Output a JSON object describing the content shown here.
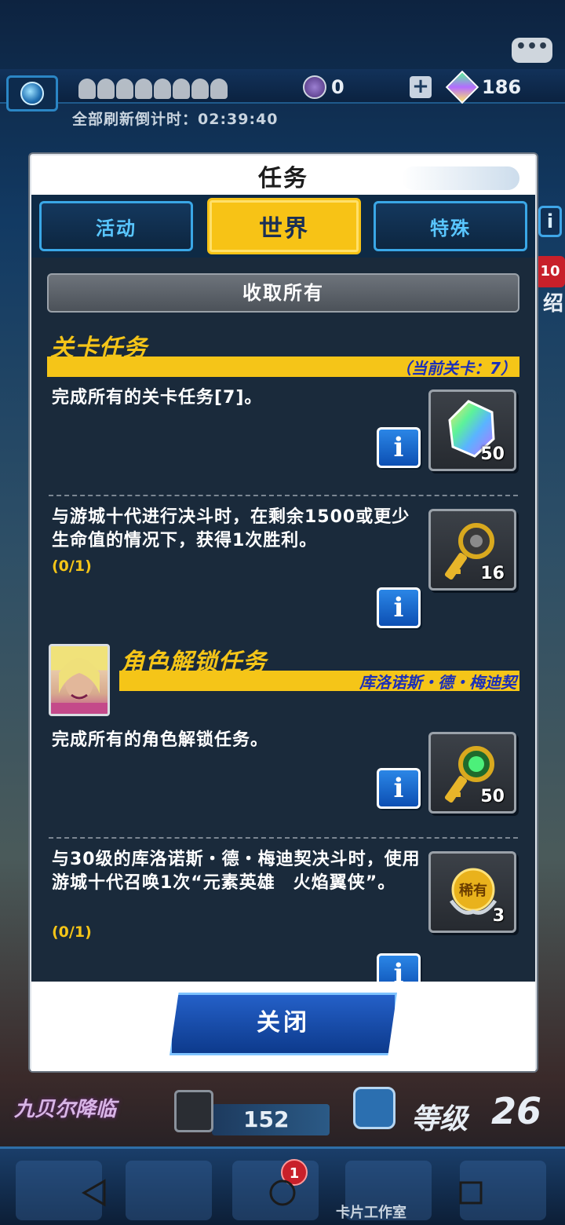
{
  "hud": {
    "chat_icon": "speech-bubble-icon",
    "coins": "0",
    "gems": "186",
    "refresh_text": "全部刷新倒计时：02:39:40",
    "side_badge": "10",
    "side_text": "绍"
  },
  "bottom": {
    "event_logo": "九贝尔降临",
    "deck_count": "152",
    "level_label": "等级",
    "level": "26",
    "cart_badge": "1",
    "card_studio": "卡片工作室"
  },
  "modal": {
    "title": "任务",
    "tabs": [
      {
        "label": "活动",
        "active": false
      },
      {
        "label": "世界",
        "active": true
      },
      {
        "label": "特殊",
        "active": false
      }
    ],
    "collect_all": "收取所有",
    "sections": [
      {
        "title": "关卡任务",
        "subtitle": "（当前关卡：7）",
        "missions": [
          {
            "text": "完成所有的关卡任务[7]。",
            "progress": "",
            "reward_icon": "rainbow-gem-icon",
            "reward_qty": "50"
          },
          {
            "text": "与游城十代进行决斗时，在剩余1500或更少生命值的情况下，获得1次胜利。",
            "progress": "(0/1)",
            "reward_icon": "gold-key-icon",
            "reward_qty": "16"
          }
        ]
      },
      {
        "title": "角色解锁任务",
        "subtitle": "库洛诺斯・德・梅迪契",
        "missions": [
          {
            "text": "完成所有的角色解锁任务。",
            "progress": "",
            "reward_icon": "green-key-icon",
            "reward_qty": "50"
          },
          {
            "text": "与30级的库洛诺斯・德・梅迪契决斗时，使用游城十代召唤1次“元素英雄　火焰翼侠”。",
            "progress": "(0/1)",
            "reward_icon": "rare-medal-icon",
            "reward_qty": "3"
          }
        ]
      }
    ],
    "info_label": "i",
    "close_label": "关闭"
  },
  "colors": {
    "accent_yellow": "#f5c518",
    "panel_bg": "#1a2a3b",
    "tab_border": "#3aa7e6",
    "info_blue": "#2b86e6"
  }
}
